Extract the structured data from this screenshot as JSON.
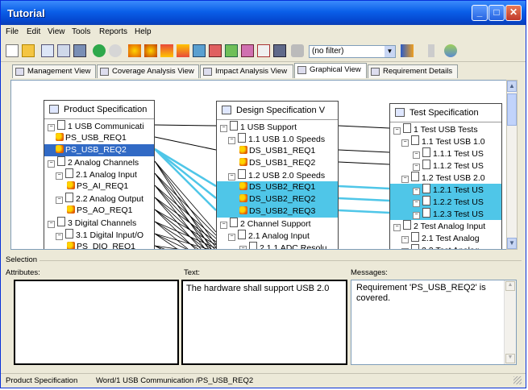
{
  "window": {
    "title": "Tutorial"
  },
  "menu": [
    "File",
    "Edit",
    "View",
    "Tools",
    "Reports",
    "Help"
  ],
  "toolbar": {
    "filter_value": "(no filter)"
  },
  "tabs": [
    "Management View",
    "Coverage Analysis View",
    "Impact Analysis View",
    "Graphical View",
    "Requirement Details"
  ],
  "active_tab": "Graphical View",
  "panels": {
    "product": {
      "title": "Product Specification",
      "rows": [
        {
          "text": "1 USB Communicati",
          "kind": "node",
          "state": "normal"
        },
        {
          "text": "PS_USB_REQ1",
          "kind": "req",
          "state": "normal"
        },
        {
          "text": "PS_USB_REQ2",
          "kind": "req",
          "state": "selected"
        },
        {
          "text": "2 Analog Channels",
          "kind": "node",
          "state": "normal"
        },
        {
          "text": "2.1 Analog Input",
          "kind": "node",
          "state": "normal"
        },
        {
          "text": "PS_AI_REQ1",
          "kind": "req",
          "state": "normal"
        },
        {
          "text": "2.2 Analog Output",
          "kind": "node",
          "state": "normal"
        },
        {
          "text": "PS_AO_REQ1",
          "kind": "req",
          "state": "normal"
        },
        {
          "text": "3 Digital Channels",
          "kind": "node",
          "state": "normal"
        },
        {
          "text": "3.1 Digital Input/O",
          "kind": "node",
          "state": "normal"
        },
        {
          "text": "PS_DIO_REQ1",
          "kind": "req",
          "state": "normal"
        }
      ]
    },
    "design": {
      "title": "Design Specification  V",
      "rows": [
        {
          "text": "1 USB Support",
          "kind": "node",
          "state": "normal"
        },
        {
          "text": "1.1 USB 1.0 Speeds",
          "kind": "node",
          "state": "normal"
        },
        {
          "text": "DS_USB1_REQ1",
          "kind": "req",
          "state": "normal"
        },
        {
          "text": "DS_USB1_REQ2",
          "kind": "req",
          "state": "normal"
        },
        {
          "text": "1.2 USB 2.0 Speeds",
          "kind": "node",
          "state": "normal"
        },
        {
          "text": "DS_USB2_REQ1",
          "kind": "req",
          "state": "highlighted"
        },
        {
          "text": "DS_USB2_REQ2",
          "kind": "req",
          "state": "highlighted"
        },
        {
          "text": "DS_USB2_REQ3",
          "kind": "req",
          "state": "highlighted"
        },
        {
          "text": "2 Channel Support",
          "kind": "node",
          "state": "normal"
        },
        {
          "text": "2.1 Analog Input",
          "kind": "node",
          "state": "normal"
        },
        {
          "text": "2.1.1 ADC Resolu",
          "kind": "node",
          "state": "normal"
        }
      ]
    },
    "test": {
      "title": "Test Specification",
      "rows": [
        {
          "text": "1 Test USB Tests",
          "kind": "node",
          "state": "normal"
        },
        {
          "text": "1.1 Test USB 1.0",
          "kind": "node",
          "state": "normal"
        },
        {
          "text": "1.1.1 Test US",
          "kind": "node",
          "state": "normal"
        },
        {
          "text": "1.1.2 Test US",
          "kind": "node",
          "state": "normal"
        },
        {
          "text": "1.2 Test USB 2.0",
          "kind": "node",
          "state": "normal"
        },
        {
          "text": "1.2.1 Test US",
          "kind": "node",
          "state": "highlighted"
        },
        {
          "text": "1.2.2 Test US",
          "kind": "node",
          "state": "highlighted"
        },
        {
          "text": "1.2.3 Test US",
          "kind": "node",
          "state": "highlighted"
        },
        {
          "text": "2 Test Analog Input",
          "kind": "node",
          "state": "normal"
        },
        {
          "text": "2.1 Test Analog",
          "kind": "node",
          "state": "normal"
        },
        {
          "text": "2.2 Test Analog",
          "kind": "node",
          "state": "normal"
        }
      ]
    }
  },
  "selection": {
    "group_label": "Selection",
    "attributes_label": "Attributes:",
    "text_label": "Text:",
    "text_value": "The hardware shall support USB 2.0",
    "messages_label": "Messages:",
    "messages_value": "Requirement 'PS_USB_REQ2' is covered."
  },
  "status": {
    "left": "Product Specification",
    "right": "Word/1 USB Communication /PS_USB_REQ2"
  },
  "colors": {
    "selected": "#316ac5",
    "highlight": "#4fc6e8",
    "titlebar": "#0a5fe8"
  }
}
